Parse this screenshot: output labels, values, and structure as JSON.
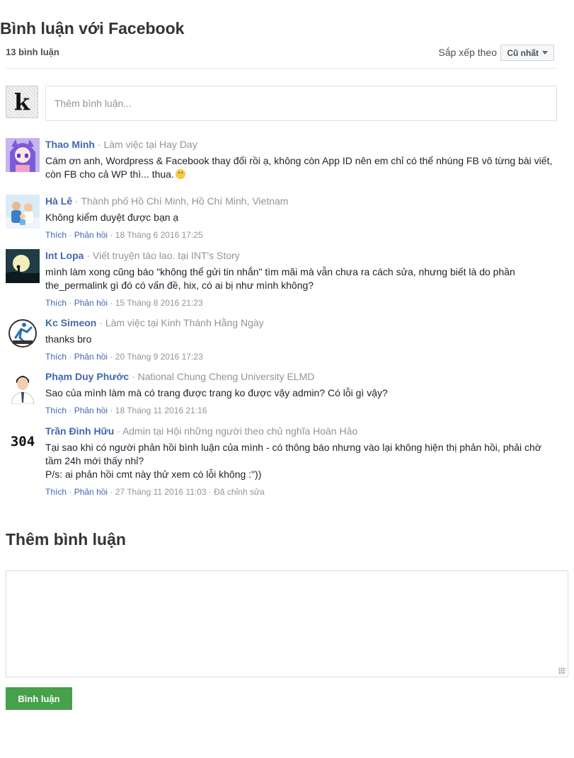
{
  "plugin": {
    "title": "Bình luận với Facebook",
    "comment_count": "13 bình luận",
    "sort": {
      "label": "Sắp xếp theo",
      "selected": "Cũ nhất"
    },
    "composer": {
      "avatar_letter": "k",
      "placeholder": "Thêm bình luận..."
    }
  },
  "comments": [
    {
      "name": "Thao Minh",
      "meta": "Làm việc tại Hay Day",
      "text": "Cám ơn anh, Wordpress & Facebook thay đổi rồi ạ, không còn App ID nên em chỉ có thể nhúng FB vô từng bài viết, còn FB cho cả WP thì... thua."
    },
    {
      "name": "Hà Lê",
      "meta": "Thành phố Hồ Chí Minh, Hồ Chí Minh, Vietnam",
      "text": "Không kiểm duyệt được bạn ạ",
      "like": "Thích",
      "reply": "Phản hồi",
      "time": "18 Tháng 6 2016 17:25"
    },
    {
      "name": "Int Lopa",
      "meta": "Viết truyện tào lao. tại INT's Story",
      "text": "mình làm xong cũng báo \"không thể gửi tin nhắn\" tìm mãi mà vẫn chưa ra cách sửa, nhưng biết là do phần the_permalink gì đó có vấn đề, hix, có ai bị như mình không?",
      "like": "Thích",
      "reply": "Phản hồi",
      "time": "15 Tháng 8 2016 21:23"
    },
    {
      "name": "Kc Simeon",
      "meta": "Làm việc tại Kinh Thánh Hằng Ngày",
      "text": "thanks bro",
      "like": "Thích",
      "reply": "Phản hồi",
      "time": "20 Tháng 9 2016 17:23"
    },
    {
      "name": "Phạm Duy Phước",
      "meta": "National Chung Cheng University ELMD",
      "text": "Sao của mình làm mà có trang được trang ko được vậy admin? Có lỗi gì vậy?",
      "like": "Thích",
      "reply": "Phản hồi",
      "time": "18 Tháng 11 2016 21:16"
    },
    {
      "name": "Trần Đình Hữu",
      "meta": "Admin tại Hội những người theo chủ nghĩa Hoàn Hảo",
      "text": "Tại sao khi có người phản hồi bình luận của mình - có thông báo nhưng vào lại không hiện thị phản hồi, phải chờ tầm 24h mới thấy nhỉ?",
      "text2": "P/s: ai phản hồi cmt này thử xem có lỗi không :\"))",
      "like": "Thích",
      "reply": "Phản hồi",
      "time": "27 Tháng 11 2016 11:03",
      "edited": "Đã chỉnh sửa",
      "avatar_text": "304"
    }
  ],
  "separator": "·",
  "add_comment": {
    "title": "Thêm bình luận",
    "submit": "Bình luận"
  },
  "colors": {
    "name_link": "#4267b2",
    "meta_gray": "#90949c",
    "submit_green": "#45a14a"
  }
}
